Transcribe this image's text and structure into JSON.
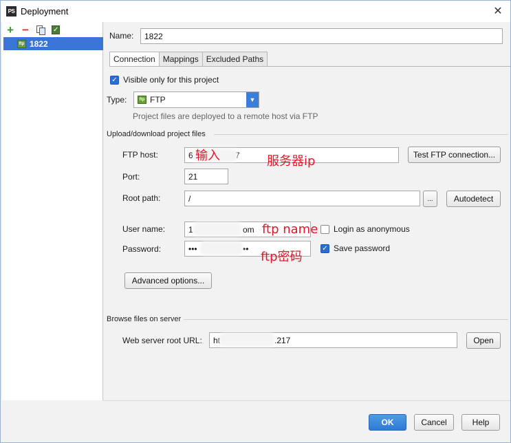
{
  "window": {
    "title": "Deployment",
    "app_icon_text": "PS",
    "close_glyph": "✕"
  },
  "left": {
    "toolbar": {
      "add": "+",
      "remove": "−"
    },
    "servers": [
      {
        "name": "1822",
        "icon": "ftp-icon",
        "selected": true
      }
    ]
  },
  "form": {
    "name_label": "Name:",
    "name_value": "1822",
    "tabs": [
      {
        "label": "Connection",
        "active": true
      },
      {
        "label": "Mappings",
        "active": false
      },
      {
        "label": "Excluded Paths",
        "active": false
      }
    ],
    "visible_only": {
      "label": "Visible only for this project",
      "checked": true
    },
    "type_label": "Type:",
    "type_value": "FTP",
    "type_hint": "Project files are deployed to a remote host via FTP",
    "ftp_icon_text": "ftp",
    "upload_section": "Upload/download project files",
    "ftp_host_label": "FTP host:",
    "ftp_host_value": "6",
    "ftp_host_tail": "7",
    "test_button": "Test FTP connection...",
    "port_label": "Port:",
    "port_value": "21",
    "root_path_label": "Root path:",
    "root_path_value": "/",
    "browse_button": "...",
    "autodetect_button": "Autodetect",
    "username_label": "User name:",
    "username_value": "1",
    "username_tail": "om",
    "login_anonymous": {
      "label": "Login as anonymous",
      "checked": false
    },
    "password_label": "Password:",
    "password_value": "•••",
    "password_tail": "••",
    "save_password": {
      "label": "Save password",
      "checked": true
    },
    "advanced_button": "Advanced options...",
    "browse_section": "Browse files on server",
    "web_url_label": "Web server root URL:",
    "web_url_value": "ht",
    "web_url_tail": ".217",
    "open_button": "Open"
  },
  "annotations": {
    "input": "输入",
    "server_ip": "服务器ip",
    "ftp_name": "ftp name",
    "ftp_password": "ftp密码"
  },
  "footer": {
    "ok": "OK",
    "cancel": "Cancel",
    "help": "Help"
  },
  "colors": {
    "accent": "#3875d7",
    "annotation": "#e8142a"
  }
}
